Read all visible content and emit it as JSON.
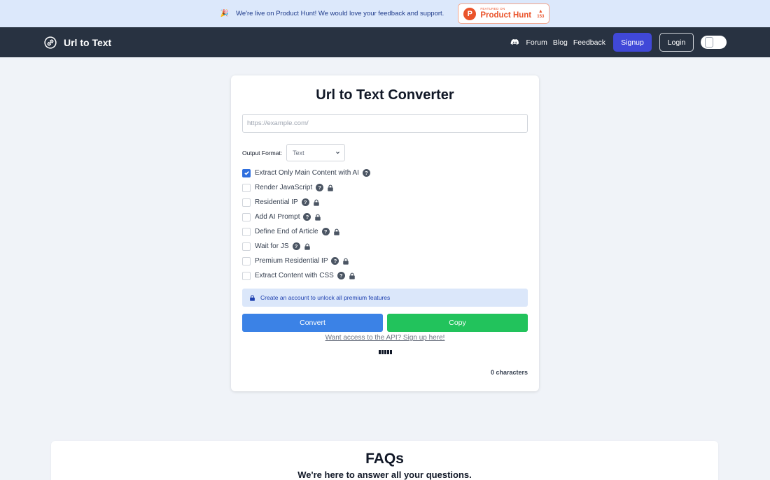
{
  "banner": {
    "party_icon": "party-popper-icon",
    "text": "We're live on Product Hunt! We would love your feedback and support.",
    "ph_small": "FEATURED ON",
    "ph_name": "Product Hunt",
    "ph_letter": "P",
    "ph_votes": "153"
  },
  "navbar": {
    "brand": "Url to Text",
    "links": [
      "Forum",
      "Blog",
      "Feedback"
    ],
    "signup": "Signup",
    "login": "Login"
  },
  "converter": {
    "title": "Url to Text Converter",
    "url_placeholder": "https://example.com/",
    "url_value": "",
    "output_format_label": "Output Format:",
    "output_format_value": "Text",
    "options": [
      {
        "label": "Extract Only Main Content with AI",
        "checked": true,
        "locked": false
      },
      {
        "label": "Render JavaScript",
        "checked": false,
        "locked": true
      },
      {
        "label": "Residential IP",
        "checked": false,
        "locked": true
      },
      {
        "label": "Add AI Prompt",
        "checked": false,
        "locked": true
      },
      {
        "label": "Define End of Article",
        "checked": false,
        "locked": true
      },
      {
        "label": "Wait for JS",
        "checked": false,
        "locked": true
      },
      {
        "label": "Premium Residential IP",
        "checked": false,
        "locked": true
      },
      {
        "label": "Extract Content with CSS",
        "checked": false,
        "locked": true
      }
    ],
    "help_glyph": "?",
    "notice": "Create an account to unlock all premium features",
    "convert_label": "Convert",
    "copy_label": "Copy",
    "api_link": "Want access to the API? Sign up here!",
    "char_count": "0 characters"
  },
  "faq": {
    "title": "FAQs",
    "subtitle": "We're here to answer all your questions."
  },
  "colors": {
    "banner_bg": "#dce8fb",
    "navbar_bg": "#283241",
    "signup_bg": "#4048d8",
    "convert_bg": "#3b82e6",
    "copy_bg": "#22c35c",
    "product_hunt": "#ea532a"
  }
}
